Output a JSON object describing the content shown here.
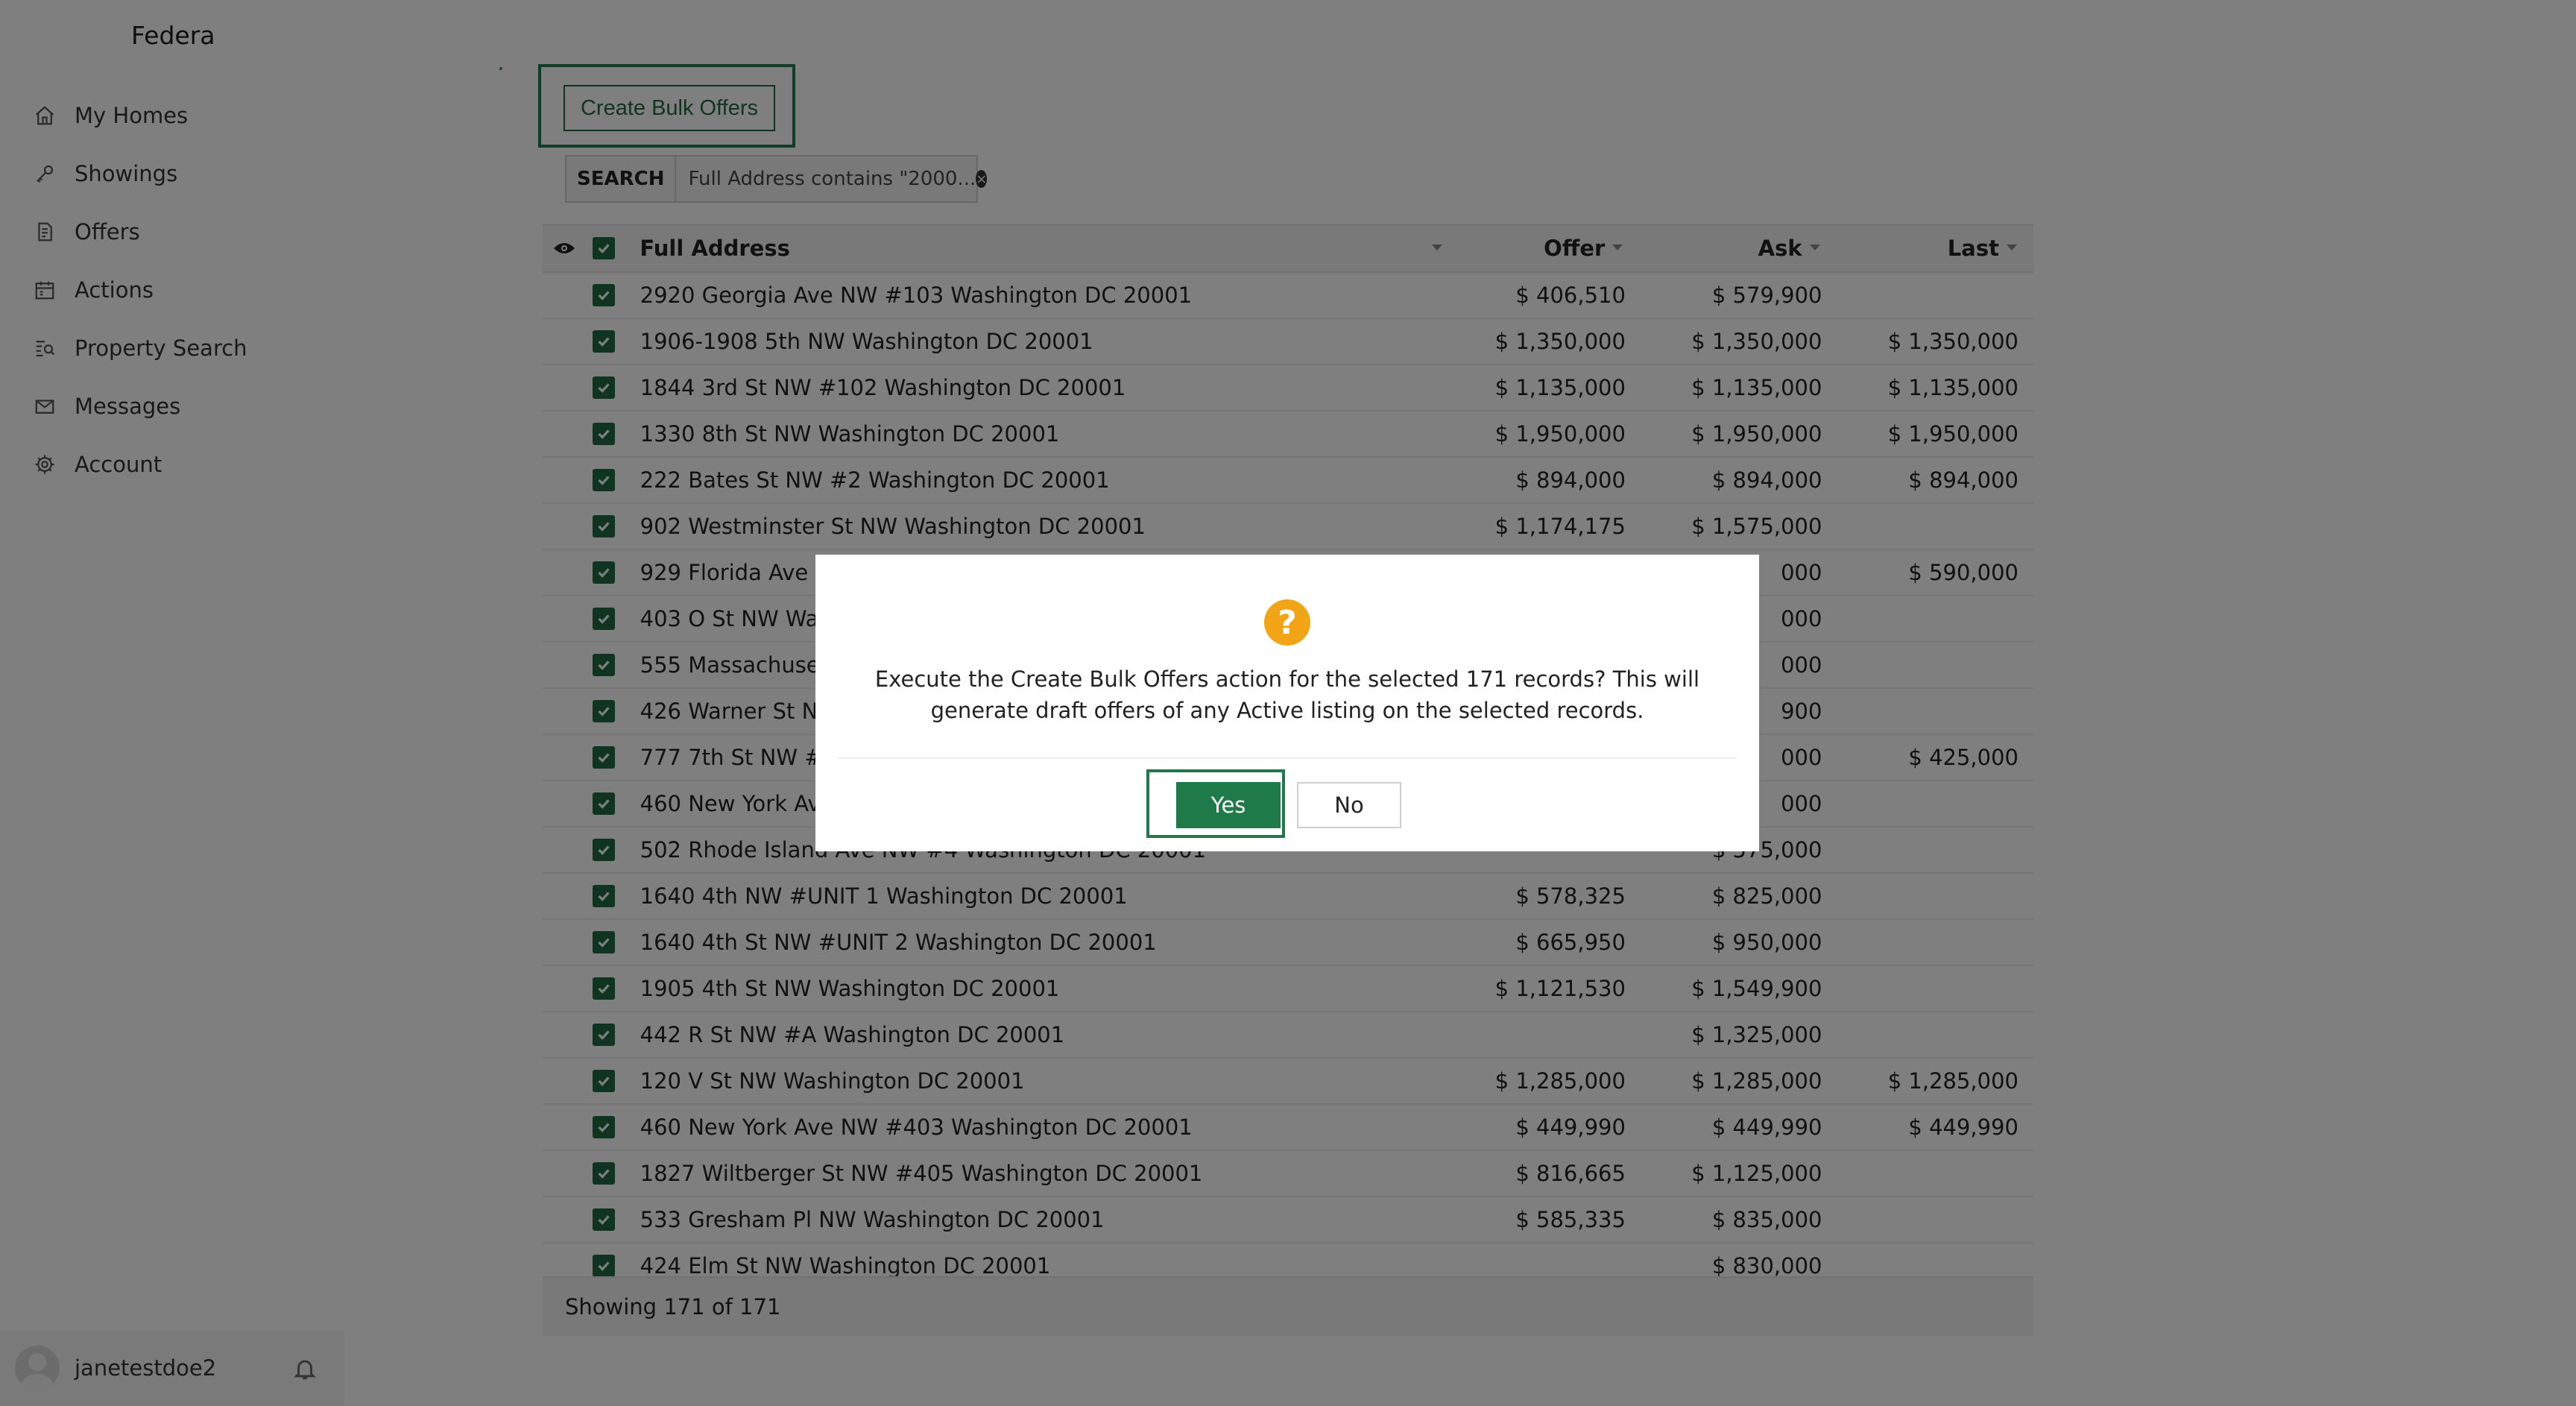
{
  "app": {
    "name": "Federa"
  },
  "sidebar": {
    "items": [
      {
        "label": "My Homes",
        "icon": "home-icon"
      },
      {
        "label": "Showings",
        "icon": "key-icon"
      },
      {
        "label": "Offers",
        "icon": "document-icon"
      },
      {
        "label": "Actions",
        "icon": "calendar-icon"
      },
      {
        "label": "Property Search",
        "icon": "search-list-icon"
      },
      {
        "label": "Messages",
        "icon": "mail-icon"
      },
      {
        "label": "Account",
        "icon": "gear-icon"
      }
    ],
    "user": {
      "name": "janetestdoe2",
      "bell_icon": "bell-icon"
    }
  },
  "toolbar": {
    "bulk_label": "Create Bulk Offers"
  },
  "search": {
    "tag": "SEARCH",
    "value": "Full Address contains \"2000..."
  },
  "table": {
    "headers": {
      "address": "Full Address",
      "offer": "Offer",
      "ask": "Ask",
      "last": "Last"
    },
    "rows": [
      {
        "address": "2920 Georgia Ave NW #103 Washington DC 20001",
        "offer": "$ 406,510",
        "ask": "$ 579,900",
        "last": ""
      },
      {
        "address": "1906-1908 5th NW Washington DC 20001",
        "offer": "$ 1,350,000",
        "ask": "$ 1,350,000",
        "last": "$ 1,350,000"
      },
      {
        "address": "1844 3rd St NW #102 Washington DC 20001",
        "offer": "$ 1,135,000",
        "ask": "$ 1,135,000",
        "last": "$ 1,135,000"
      },
      {
        "address": "1330 8th St NW Washington DC 20001",
        "offer": "$ 1,950,000",
        "ask": "$ 1,950,000",
        "last": "$ 1,950,000"
      },
      {
        "address": "222 Bates St NW #2 Washington DC 20001",
        "offer": "$ 894,000",
        "ask": "$ 894,000",
        "last": "$ 894,000"
      },
      {
        "address": "902 Westminster St NW Washington DC 20001",
        "offer": "$ 1,174,175",
        "ask": "$ 1,575,000",
        "last": ""
      },
      {
        "address": "929 Florida Ave NW",
        "offer": "",
        "ask": "000",
        "last": "$ 590,000"
      },
      {
        "address": "403 O St NW Wash",
        "offer": "",
        "ask": "000",
        "last": ""
      },
      {
        "address": "555 Massachusett",
        "offer": "",
        "ask": "000",
        "last": ""
      },
      {
        "address": "426 Warner St NW",
        "offer": "",
        "ask": "900",
        "last": ""
      },
      {
        "address": "777 7th St NW #71",
        "offer": "",
        "ask": "000",
        "last": "$ 425,000"
      },
      {
        "address": "460 New York Ave",
        "offer": "",
        "ask": "000",
        "last": ""
      },
      {
        "address": "502 Rhode Island Ave NW #4 Washington DC 20001",
        "offer": "",
        "ask": "$ 575,000",
        "last": ""
      },
      {
        "address": "1640 4th NW #UNIT 1 Washington DC 20001",
        "offer": "$ 578,325",
        "ask": "$ 825,000",
        "last": ""
      },
      {
        "address": "1640 4th St NW #UNIT 2 Washington DC 20001",
        "offer": "$ 665,950",
        "ask": "$ 950,000",
        "last": ""
      },
      {
        "address": "1905 4th St NW Washington DC 20001",
        "offer": "$ 1,121,530",
        "ask": "$ 1,549,900",
        "last": ""
      },
      {
        "address": "442 R St NW #A Washington DC 20001",
        "offer": "",
        "ask": "$ 1,325,000",
        "last": ""
      },
      {
        "address": "120 V St NW Washington DC 20001",
        "offer": "$ 1,285,000",
        "ask": "$ 1,285,000",
        "last": "$ 1,285,000"
      },
      {
        "address": "460 New York Ave NW #403 Washington DC 20001",
        "offer": "$ 449,990",
        "ask": "$ 449,990",
        "last": "$ 449,990"
      },
      {
        "address": "1827 Wiltberger St NW #405 Washington DC 20001",
        "offer": "$ 816,665",
        "ask": "$ 1,125,000",
        "last": ""
      },
      {
        "address": "533 Gresham Pl NW Washington DC 20001",
        "offer": "$ 585,335",
        "ask": "$ 835,000",
        "last": ""
      },
      {
        "address": "424 Elm St NW Washington DC 20001",
        "offer": "",
        "ask": "$ 830,000",
        "last": ""
      }
    ],
    "footer": "Showing 171 of 171"
  },
  "modal": {
    "icon": "question-icon",
    "message": "Execute the Create Bulk Offers action for the selected 171 records? This will generate draft offers of any Active listing on the selected records.",
    "yes_label": "Yes",
    "no_label": "No"
  },
  "colors": {
    "accent": "#1f7a4a",
    "warning": "#f2a417",
    "overlay": "rgba(0,0,0,0.5)"
  }
}
